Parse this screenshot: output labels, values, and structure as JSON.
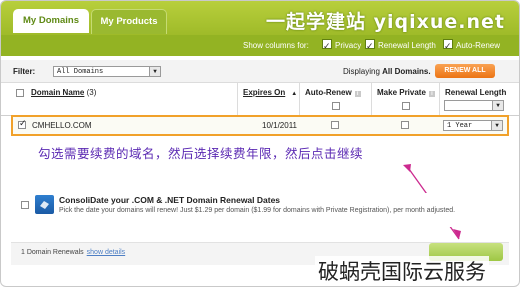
{
  "tabs": [
    {
      "label": "My Domains",
      "active": true
    },
    {
      "label": "My Products",
      "active": false
    }
  ],
  "watermark": "一起学建站 yiqixue.net",
  "columns_bar": {
    "label": "Show columns for:",
    "options": [
      {
        "label": "Privacy",
        "checked": true
      },
      {
        "label": "Renewal Length",
        "checked": true
      },
      {
        "label": "Auto-Renew",
        "checked": true
      }
    ]
  },
  "filter": {
    "label": "Filter:",
    "selected": "All Domains",
    "displaying_prefix": "Displaying ",
    "displaying_bold": "All Domains.",
    "renew_all_label": "RENEW ALL"
  },
  "table": {
    "headers": {
      "domain_name": "Domain Name",
      "domain_count": "(3)",
      "expires_on": "Expires On",
      "auto_renew": "Auto-Renew",
      "make_private": "Make Private",
      "renewal_length": "Renewal Length"
    },
    "row": {
      "checked": true,
      "domain": "CMHELLO.COM",
      "expires": "10/1/2011",
      "auto_renew": false,
      "make_private": false,
      "renewal_length": "1 Year"
    }
  },
  "annotation": "勾选需要续费的域名，然后选择续费年限，然后点击继续",
  "consolidate": {
    "title": "ConsoliDate your .COM & .NET Domain Renewal Dates",
    "description": "Pick the date your domains will renew! Just $1.29 per domain ($1.99 for domains with Private Registration), per month adjusted."
  },
  "footer": {
    "count_text": "1 Domain Renewals",
    "show_details": "show details"
  },
  "brand_overlay": "破蜗壳国际云服务",
  "colors": {
    "header_green": "#93b323",
    "highlight_border": "#f1a12a",
    "renew_orange": "#ec7414",
    "annotation_purple": "#5b2ab3"
  }
}
